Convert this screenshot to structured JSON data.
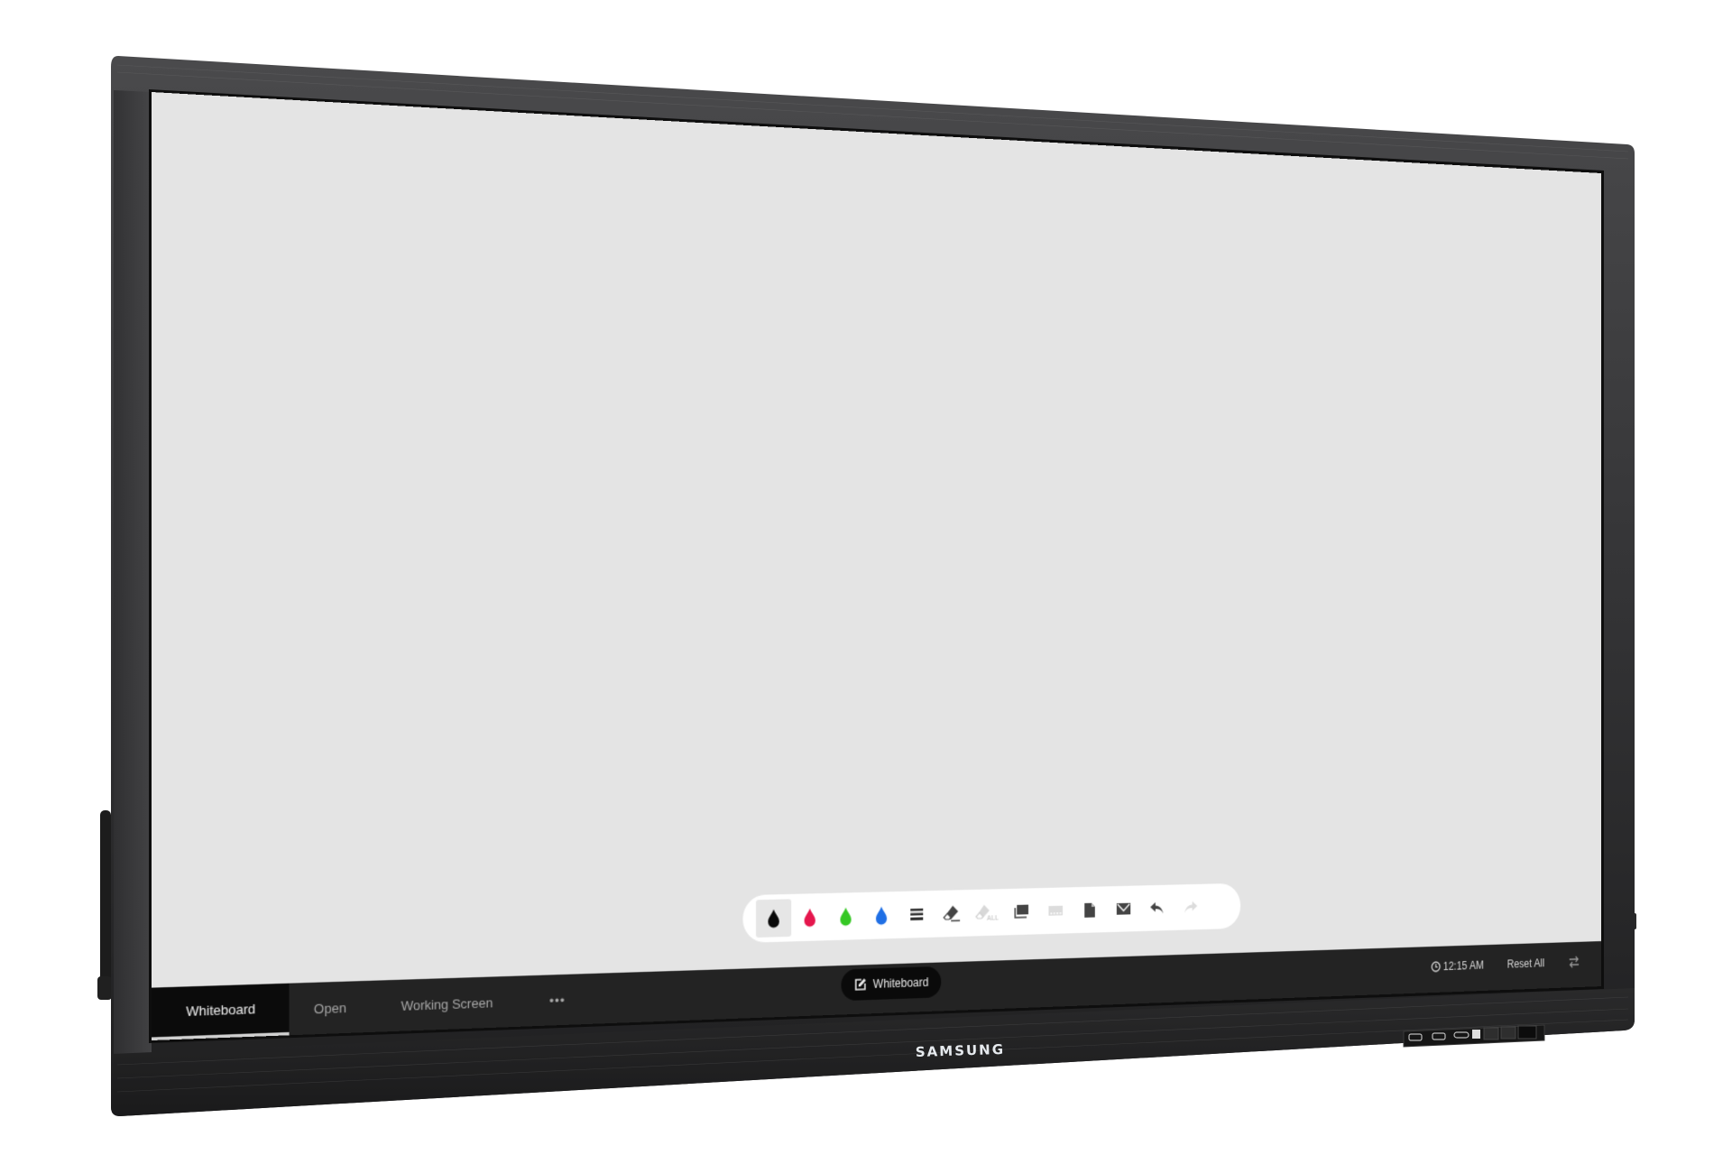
{
  "device": {
    "brand_logo": "SAMSUNG",
    "colors": {
      "bezel": "#2b2b2b",
      "screen": "#e4e4e4",
      "taskbar": "#232323",
      "active_tab": "#0b0b0b"
    }
  },
  "toolbar": {
    "tools": [
      {
        "name": "pen-black",
        "icon": "ink-drop-icon",
        "color": "#0a0a0a",
        "selected": true
      },
      {
        "name": "pen-red",
        "icon": "ink-drop-icon",
        "color": "#e5164d",
        "selected": false
      },
      {
        "name": "pen-green",
        "icon": "ink-drop-icon",
        "color": "#35c824",
        "selected": false
      },
      {
        "name": "pen-blue",
        "icon": "ink-drop-icon",
        "color": "#1f6fe5",
        "selected": false
      },
      {
        "name": "pen-thickness",
        "icon": "line-weight-icon",
        "selected": false
      },
      {
        "name": "eraser",
        "icon": "eraser-icon",
        "selected": false
      },
      {
        "name": "erase-all",
        "icon": "eraser-all-icon",
        "label": "ALL",
        "disabled": true
      },
      {
        "name": "pages",
        "icon": "pages-icon",
        "selected": false
      },
      {
        "name": "page-navigator",
        "icon": "page-strip-icon",
        "disabled": true
      },
      {
        "name": "file",
        "icon": "document-icon",
        "selected": false
      },
      {
        "name": "email",
        "icon": "mail-icon",
        "selected": false
      },
      {
        "name": "undo",
        "icon": "undo-icon",
        "selected": false
      },
      {
        "name": "redo",
        "icon": "redo-icon",
        "disabled": true
      }
    ]
  },
  "taskbar": {
    "tabs": [
      {
        "label": "Whiteboard",
        "active": true
      },
      {
        "label": "Open",
        "active": false
      },
      {
        "label": "Working Screen",
        "active": false
      },
      {
        "label": "•••",
        "active": false
      }
    ],
    "current_app": {
      "label": "Whiteboard",
      "icon": "edit-icon"
    },
    "clock": {
      "icon": "clock-icon",
      "time": "12:15 AM"
    },
    "reset_label": "Reset All",
    "switch_icon": "swap-arrows-icon"
  }
}
